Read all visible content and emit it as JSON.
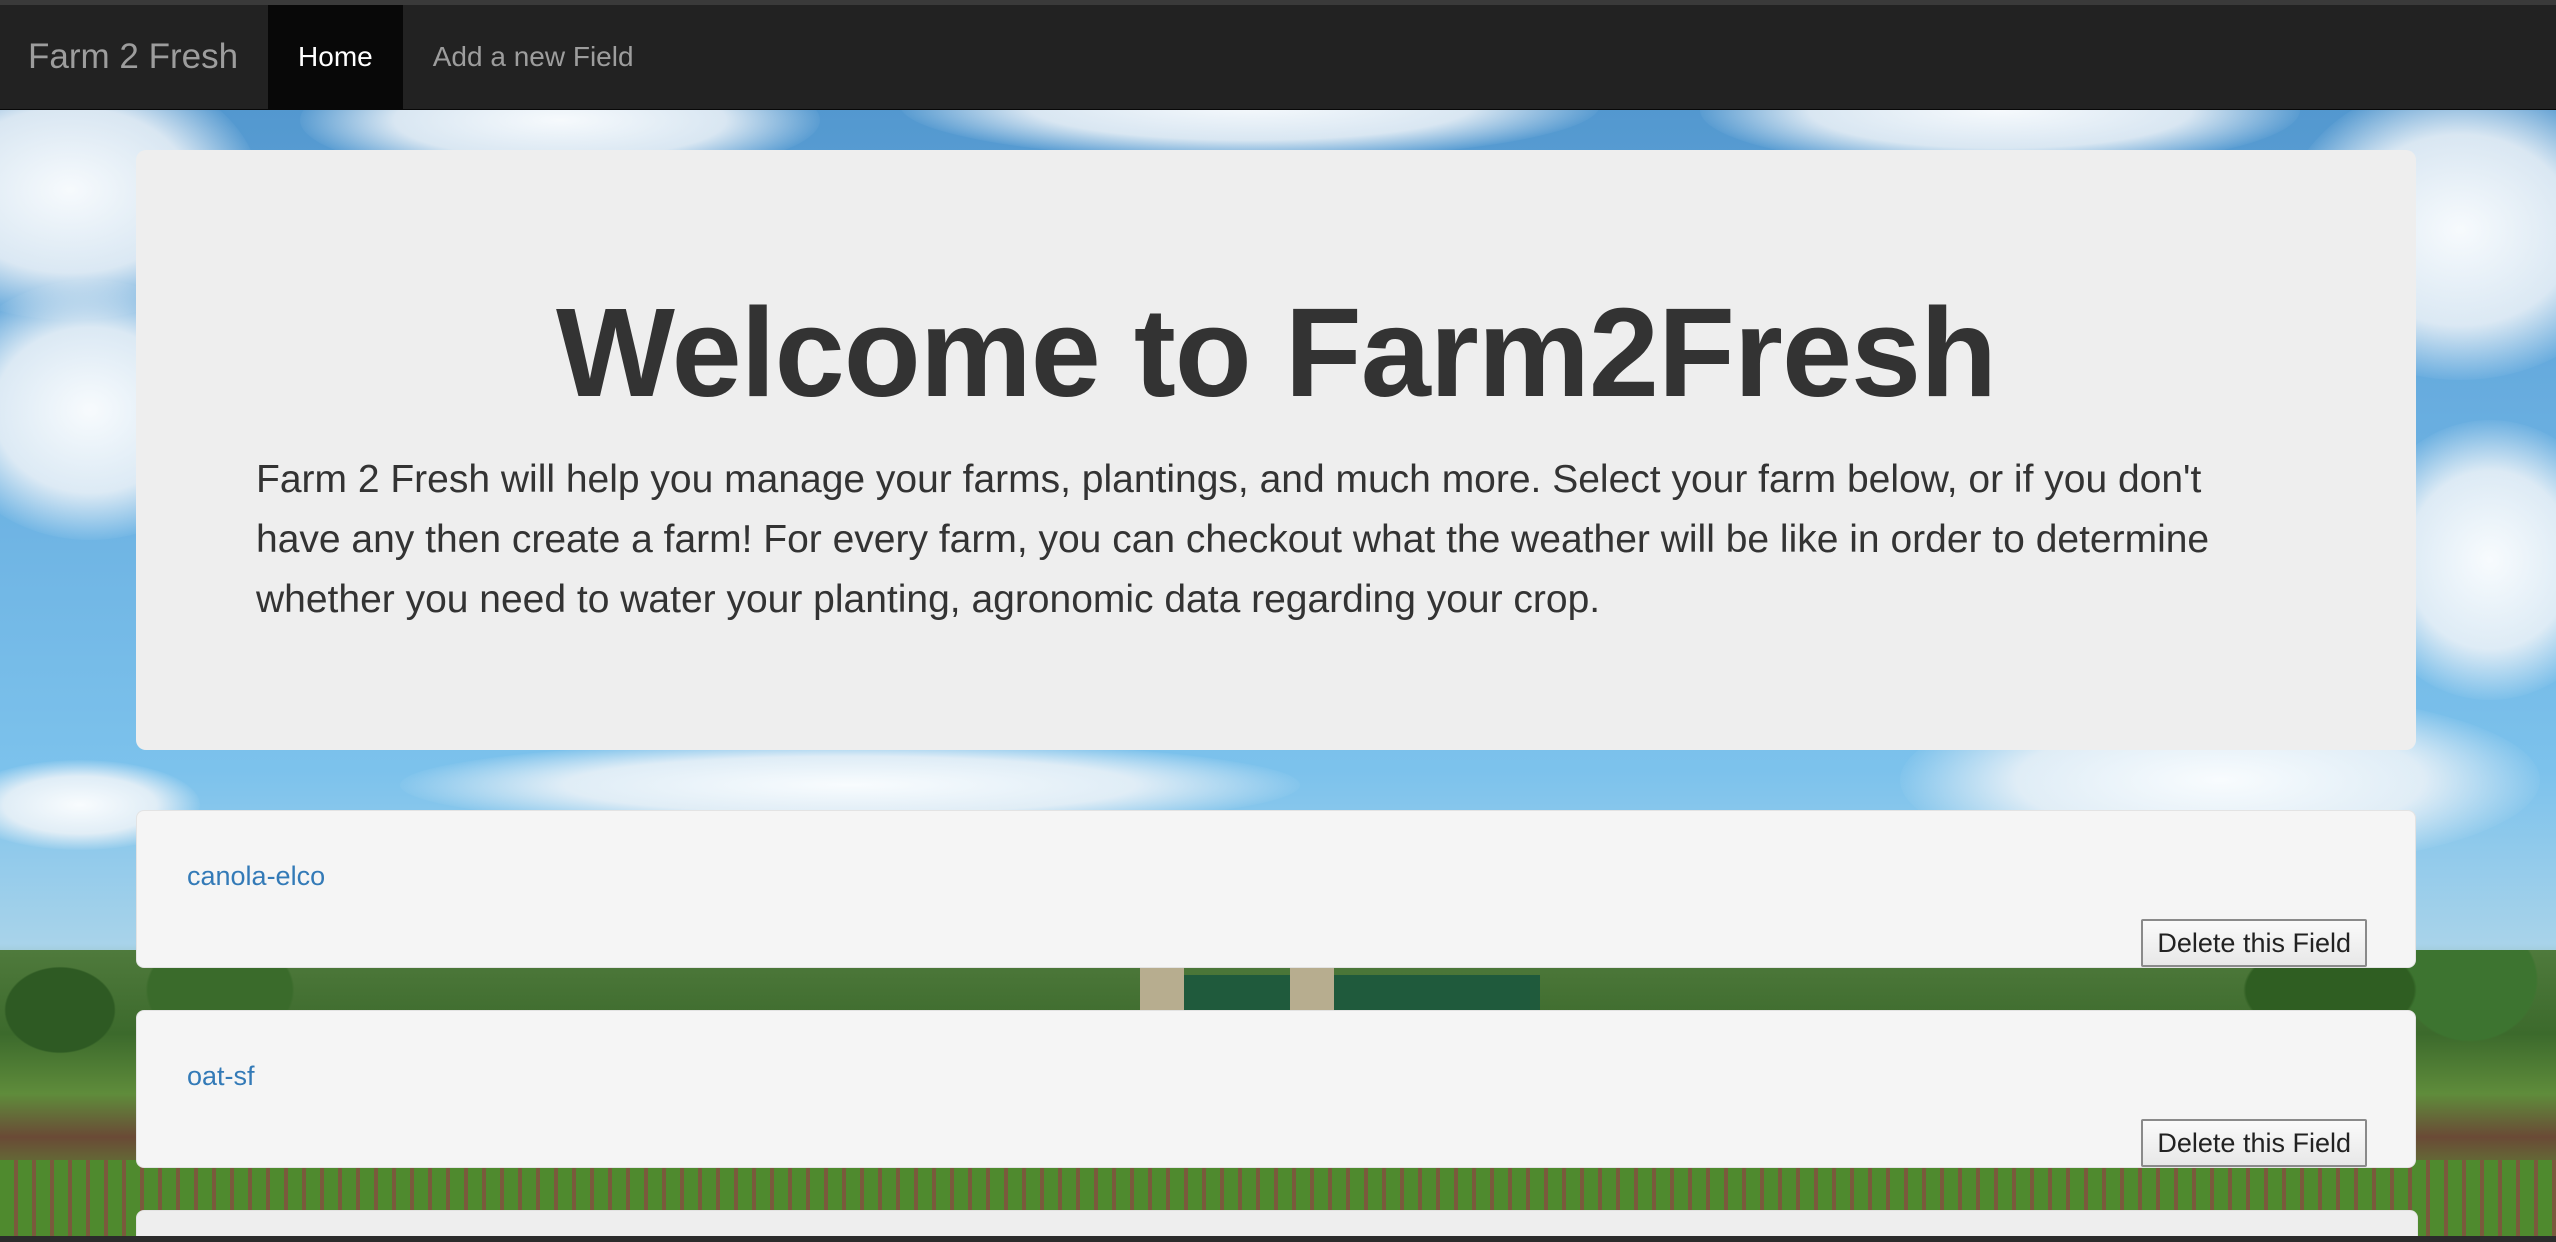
{
  "navbar": {
    "brand": "Farm 2 Fresh",
    "items": [
      {
        "label": "Home",
        "active": true
      },
      {
        "label": "Add a new Field",
        "active": false
      }
    ]
  },
  "jumbotron": {
    "title": "Welcome to Farm2Fresh",
    "description": "Farm 2 Fresh will help you manage your farms, plantings, and much more. Select your farm below, or if you don't have any then create a farm! For every farm, you can checkout what the weather will be like in order to determine whether you need to water your planting, agronomic data regarding your crop."
  },
  "fields": [
    {
      "name": "canola-elco",
      "delete_label": "Delete this Field"
    },
    {
      "name": "oat-sf",
      "delete_label": "Delete this Field"
    }
  ],
  "colors": {
    "navbar_bg": "#222222",
    "nav_active_bg": "#080808",
    "link": "#337ab7",
    "jumbotron_bg": "#eeeeee",
    "card_bg": "#f5f5f5"
  }
}
